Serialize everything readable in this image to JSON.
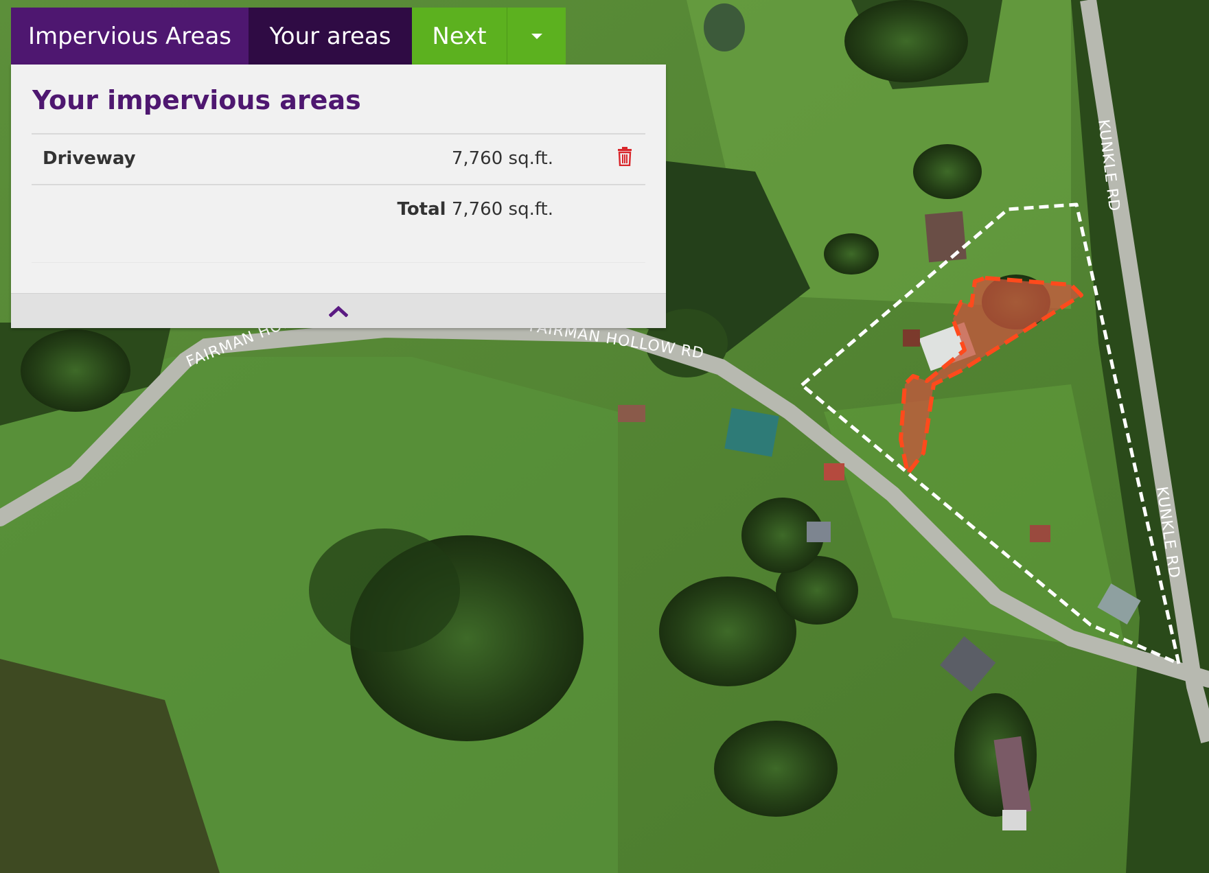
{
  "toolbar": {
    "app_title": "Impervious Areas",
    "your_areas_label": "Your areas",
    "next_label": "Next",
    "dropdown_icon": "caret-down-icon"
  },
  "panel": {
    "title": "Your impervious areas",
    "rows": [
      {
        "name": "Driveway",
        "area": "7,760 sq.ft.",
        "delete_icon": "trash-icon"
      }
    ],
    "total_label": "Total",
    "total_value": "7,760 sq.ft.",
    "collapse_icon": "chevron-up-icon"
  },
  "map": {
    "road_labels": [
      "FAIRMAN HOLLOW RD",
      "FAIRMAN HOLLOW RD",
      "KUNKLE RD",
      "KUNKLE RD"
    ],
    "parcel_outline_color": "#ffffff",
    "impervious_outline_color": "#ff4a1c",
    "impervious_fill_color": "#c8563e"
  },
  "colors": {
    "brand_purple": "#4e1770",
    "dark_purple": "#2f0b44",
    "next_green": "#5cb11f",
    "delete_red": "#d9262b"
  }
}
